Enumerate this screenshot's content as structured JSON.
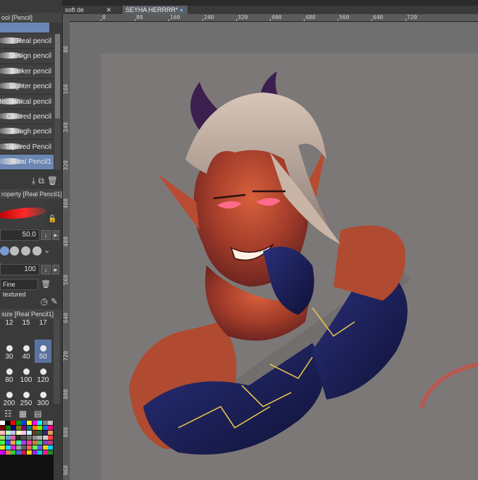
{
  "tool_panel": {
    "title": "ool [Pencil]"
  },
  "brushes": [
    {
      "label": "Real pencil",
      "active": false
    },
    {
      "label": "Design pencil",
      "active": false
    },
    {
      "label": "Darker pencil",
      "active": false
    },
    {
      "label": "Lighter pencil",
      "active": false
    },
    {
      "label": "Mechanical pencil",
      "active": false
    },
    {
      "label": "Colored pencil",
      "active": false
    },
    {
      "label": "Rough pencil",
      "active": false
    },
    {
      "label": "Tapered Pencil",
      "active": false
    },
    {
      "label": "Real Pencil1",
      "active": true
    }
  ],
  "property": {
    "title": "roperty [Real Pencil1]",
    "size_value": "50.0",
    "opacity_label": "ity",
    "opacity_value": "100",
    "texture_label": "Fine textured"
  },
  "brush_size": {
    "title": "size [Real Pencil1]",
    "sizes": [
      "12",
      "15",
      "17",
      "30",
      "40",
      "50",
      "80",
      "100",
      "120",
      "200",
      "250",
      "300"
    ],
    "selected": "50"
  },
  "tabs": [
    {
      "label": "soft de",
      "active": false
    },
    {
      "label": "SEYHA HERRRR*",
      "active": true
    }
  ],
  "ruler_h": [
    "0",
    "80",
    "160",
    "240",
    "320",
    "400",
    "480",
    "560",
    "640",
    "720"
  ],
  "ruler_v": [
    "80",
    "160",
    "240",
    "320",
    "400",
    "480",
    "560",
    "640",
    "720",
    "800",
    "880",
    "960"
  ],
  "palette_colors": [
    "#ffffff",
    "#000000",
    "#ff0000",
    "#00a000",
    "#0040ff",
    "#ffff00",
    "#ff00ff",
    "#00ffff",
    "#808080",
    "#c0c0c0",
    "#800000",
    "#008000",
    "#000080",
    "#808000",
    "#800080",
    "#008080",
    "#ff8000",
    "#80ff00",
    "#0080ff",
    "#ff0080",
    "#ffc0c0",
    "#c0ffc0",
    "#c0c0ff",
    "#ffffc0",
    "#ffc0ff",
    "#c0ffff",
    "#604020",
    "#206040",
    "#402060",
    "#e0a060",
    "#a0e060",
    "#60a0e0",
    "#e060a0",
    "#303030",
    "#505050",
    "#707070",
    "#909090",
    "#b0b0b0",
    "#d0d0d0",
    "#ff4040",
    "#40ff40",
    "#4040ff",
    "#ffa040",
    "#40ffa0",
    "#a040ff",
    "#ff40a0",
    "#c08040",
    "#40c080",
    "#8040c0",
    "#c04080",
    "#e0e020",
    "#20e0e0",
    "#e020e0",
    "#a0a0a0",
    "#606060",
    "#ff6060",
    "#60ff60",
    "#6060ff",
    "#ffd000",
    "#00d0ff",
    "#d000ff",
    "#ff7f50",
    "#32cd32",
    "#4169e1",
    "#dc143c",
    "#ffd700",
    "#8a2be2",
    "#00ced1",
    "#ff1493",
    "#228b22"
  ]
}
